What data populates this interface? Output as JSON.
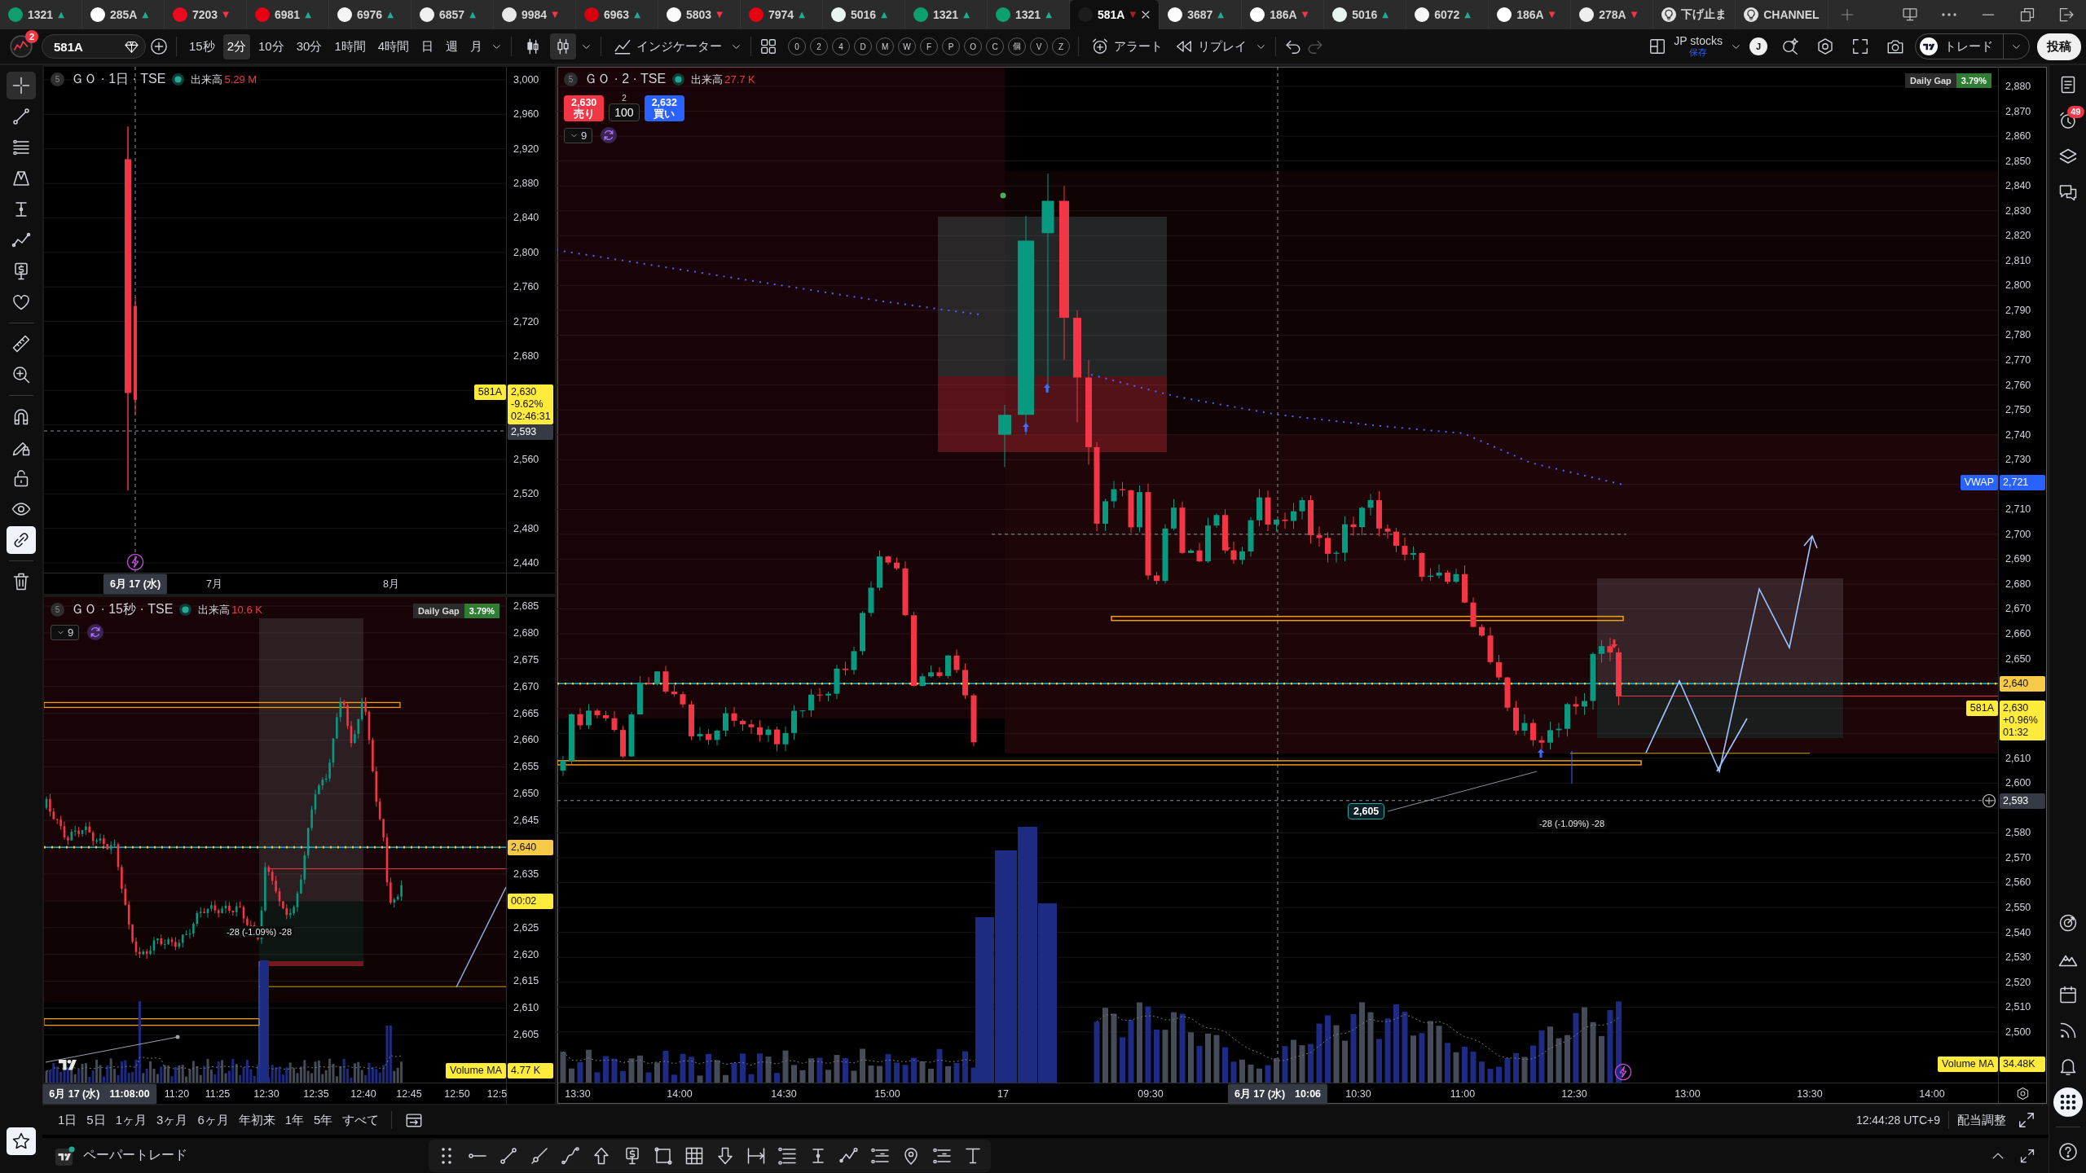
{
  "tabs": [
    {
      "kind": "symbol",
      "label": "1321",
      "trend": {
        "mark": "▲",
        "color": "#22ab94"
      },
      "color": "#0e9f6e",
      "selected": false
    },
    {
      "kind": "symbol",
      "label": "285A",
      "trend": {
        "mark": "▲",
        "color": "#22ab94"
      },
      "color": "#ffffff",
      "selected": false
    },
    {
      "kind": "symbol",
      "label": "7203",
      "trend": {
        "mark": "▼",
        "color": "#f23645"
      },
      "color": "#eb0a1e",
      "selected": false
    },
    {
      "kind": "symbol",
      "label": "6981",
      "trend": {
        "mark": "▲",
        "color": "#22ab94"
      },
      "color": "#e60012",
      "selected": false
    },
    {
      "kind": "symbol",
      "label": "6976",
      "trend": {
        "mark": "▲",
        "color": "#22ab94"
      },
      "color": "#f5f5f5",
      "selected": false
    },
    {
      "kind": "symbol",
      "label": "6857",
      "trend": {
        "mark": "▲",
        "color": "#22ab94"
      },
      "color": "#f0f0f0",
      "selected": false
    },
    {
      "kind": "symbol",
      "label": "9984",
      "trend": {
        "mark": "▼",
        "color": "#f23645"
      },
      "color": "#e8e8e8",
      "selected": false
    },
    {
      "kind": "symbol",
      "label": "6963",
      "trend": {
        "mark": "▲",
        "color": "#22ab94"
      },
      "color": "#d7000f",
      "selected": false
    },
    {
      "kind": "symbol",
      "label": "5803",
      "trend": {
        "mark": "▼",
        "color": "#f23645"
      },
      "color": "#fafafa",
      "selected": false
    },
    {
      "kind": "symbol",
      "label": "7974",
      "trend": {
        "mark": "▲",
        "color": "#22ab94"
      },
      "color": "#e60012",
      "selected": false
    },
    {
      "kind": "symbol",
      "label": "5016",
      "trend": {
        "mark": "▲",
        "color": "#22ab94"
      },
      "color": "#e9f5ef",
      "selected": false
    },
    {
      "kind": "symbol",
      "label": "1321",
      "trend": {
        "mark": "▲",
        "color": "#22ab94"
      },
      "color": "#0e9f6e",
      "selected": false
    },
    {
      "kind": "symbol",
      "label": "1321",
      "trend": {
        "mark": "▲",
        "color": "#22ab94"
      },
      "color": "#0e9f6e",
      "selected": false
    },
    {
      "kind": "symbol",
      "label": "581A",
      "trend": {
        "mark": "▼",
        "color": "#a3202c"
      },
      "color": "#1c1c1c",
      "selected": true
    },
    {
      "kind": "symbol",
      "label": "3687",
      "trend": {
        "mark": "▲",
        "color": "#22ab94"
      },
      "color": "#fcfcfc",
      "selected": false
    },
    {
      "kind": "symbol",
      "label": "186A",
      "trend": {
        "mark": "▼",
        "color": "#f23645"
      },
      "color": "#ffffff",
      "selected": false
    },
    {
      "kind": "symbol",
      "label": "5016",
      "trend": {
        "mark": "▲",
        "color": "#22ab94"
      },
      "color": "#e9f5ef",
      "selected": false
    },
    {
      "kind": "symbol",
      "label": "6072",
      "trend": {
        "mark": "▲",
        "color": "#22ab94"
      },
      "color": "#f7f7f7",
      "selected": false
    },
    {
      "kind": "symbol",
      "label": "186A",
      "trend": {
        "mark": "▼",
        "color": "#f23645"
      },
      "color": "#ffffff",
      "selected": false
    },
    {
      "kind": "symbol",
      "label": "278A",
      "trend": {
        "mark": "▼",
        "color": "#f23645"
      },
      "color": "#eeeeee",
      "selected": false
    },
    {
      "kind": "script",
      "label": "下げ止ま",
      "selected": false
    },
    {
      "kind": "script",
      "label": "CHANNEL",
      "selected": false
    }
  ],
  "toolbar": {
    "notification_count": "2",
    "symbol": "581A",
    "intervals": [
      {
        "label": "15秒",
        "selected": false
      },
      {
        "label": "2分",
        "selected": true
      },
      {
        "label": "10分",
        "selected": false
      },
      {
        "label": "30分",
        "selected": false
      },
      {
        "label": "1時間",
        "selected": false
      },
      {
        "label": "4時間",
        "selected": false
      },
      {
        "label": "日",
        "selected": false
      },
      {
        "label": "週",
        "selected": false
      },
      {
        "label": "月",
        "selected": false
      }
    ],
    "chart_types": [
      {
        "kind": "candles",
        "selected": false
      },
      {
        "kind": "hollow_candles",
        "selected": true
      }
    ],
    "indicators": "インジケーター",
    "quick_buttons": [
      "0",
      "2",
      "4",
      "D",
      "M",
      "W",
      "F",
      "P",
      "O",
      "C",
      "個",
      "V",
      "Z"
    ],
    "alert": "アラート",
    "replay": "リプレイ",
    "layout_name": "JP stocks",
    "layout_status": "保存",
    "user_initial": "J",
    "trade": "トレード",
    "publish": "投稿"
  },
  "left_toolbar": {
    "tool_groups": [
      [
        {
          "kind": "crosshair",
          "selected": true
        },
        {
          "kind": "trend_line",
          "selected": false
        },
        {
          "kind": "parallel_lines",
          "selected": false
        },
        {
          "kind": "pattern",
          "selected": false
        },
        {
          "kind": "measure",
          "selected": false
        },
        {
          "kind": "path",
          "selected": false
        },
        {
          "kind": "price_note",
          "selected": false
        },
        {
          "kind": "heart",
          "selected": false
        }
      ],
      [
        {
          "kind": "ruler",
          "selected": false
        },
        {
          "kind": "zoom",
          "selected": false
        }
      ]
    ],
    "toggles": [
      {
        "kind": "magnet",
        "on": false
      },
      {
        "kind": "pencil_lock",
        "on": false
      },
      {
        "kind": "lock",
        "on": false
      },
      {
        "kind": "eye",
        "on": false
      },
      {
        "kind": "link",
        "on": true
      }
    ],
    "favorites_on": true
  },
  "charts": [
    {
      "badge": "5",
      "title": "ＧＯ · 1日 · TSE",
      "volume_label": "出来高",
      "volume_value": "5.29 M",
      "price_axis": [
        "3,000",
        "2,960",
        "2,920",
        "2,880",
        "2,840",
        "2,800",
        "2,760",
        "2,720",
        "2,680",
        "2,560",
        "2,520",
        "2,480",
        "2,440"
      ],
      "time_axis": [
        {
          "kind": "cursor",
          "label": "6月 17 (水)"
        },
        {
          "kind": "tick",
          "label": "7月"
        },
        {
          "kind": "tick",
          "label": "8月"
        }
      ],
      "price_tags": [
        {
          "kind": "last",
          "label": "581A",
          "lines": [
            "2,630",
            "-9.62%",
            "02:46:31"
          ]
        },
        {
          "kind": "cursor",
          "lines": [
            "2,593"
          ]
        }
      ]
    },
    {
      "badge": "5",
      "title": "ＧＯ · 15秒 · TSE",
      "volume_label": "出来高",
      "volume_value": "10.6 K",
      "indicator_toggle": "9",
      "daily_gap": {
        "label": "Daily Gap",
        "value": "3.79%"
      },
      "measure_label": "-28 (-1.09%) -28",
      "price_axis": [
        "2,685",
        "2,680",
        "2,675",
        "2,670",
        "2,665",
        "2,660",
        "2,655",
        "2,650",
        "2,645",
        "2,635",
        "2,625",
        "2,620",
        "2,615",
        "2,610",
        "2,605"
      ],
      "time_axis": [
        {
          "kind": "cursor",
          "label": "6月 17 (水)",
          "time": "11:08:00"
        },
        {
          "kind": "tick",
          "label": "11:20"
        },
        {
          "kind": "tick",
          "label": "11:25"
        },
        {
          "kind": "tick",
          "label": "12:30"
        },
        {
          "kind": "tick",
          "label": "12:35"
        },
        {
          "kind": "tick",
          "label": "12:40"
        },
        {
          "kind": "tick",
          "label": "12:45"
        },
        {
          "kind": "tick",
          "label": "12:50"
        },
        {
          "kind": "tick",
          "label": "12:5"
        }
      ],
      "price_tags": [
        {
          "kind": "line",
          "lines": [
            "2,640"
          ]
        },
        {
          "kind": "countdown",
          "lines": [
            "00:02"
          ]
        },
        {
          "kind": "volume_ma",
          "label": "Volume MA",
          "lines": [
            "4.77 K"
          ]
        }
      ]
    },
    {
      "badge": "5",
      "title": "ＧＯ · 2 · TSE",
      "volume_label": "出来高",
      "volume_value": "27.7 K",
      "order_panel": {
        "sell_price": "2,630",
        "sell_label": "売り",
        "quantity_step": "2",
        "quantity": "100",
        "buy_price": "2,632",
        "buy_label": "買い"
      },
      "indicator_toggle": "9",
      "daily_gap": {
        "label": "Daily Gap",
        "value": "3.79%"
      },
      "price_note": "2,605",
      "measure_label": "-28 (-1.09%) -28",
      "price_axis": [
        "2,880",
        "2,870",
        "2,860",
        "2,850",
        "2,840",
        "2,830",
        "2,820",
        "2,810",
        "2,800",
        "2,790",
        "2,780",
        "2,770",
        "2,760",
        "2,750",
        "2,740",
        "2,730",
        "2,710",
        "2,700",
        "2,690",
        "2,680",
        "2,670",
        "2,660",
        "2,650",
        "2,610",
        "2,600",
        "2,580",
        "2,570",
        "2,560",
        "2,550",
        "2,540",
        "2,530",
        "2,520",
        "2,510",
        "2,500"
      ],
      "time_axis": [
        {
          "kind": "tick",
          "label": "13:30"
        },
        {
          "kind": "tick",
          "label": "14:00"
        },
        {
          "kind": "tick",
          "label": "14:30"
        },
        {
          "kind": "tick",
          "label": "15:00"
        },
        {
          "kind": "tick",
          "label": "17"
        },
        {
          "kind": "tick",
          "label": "09:30"
        },
        {
          "kind": "cursor",
          "label": "6月 17 (水)",
          "time": "10:06"
        },
        {
          "kind": "tick",
          "label": "10:30"
        },
        {
          "kind": "tick",
          "label": "11:00"
        },
        {
          "kind": "tick",
          "label": "12:30"
        },
        {
          "kind": "tick",
          "label": "13:00"
        },
        {
          "kind": "tick",
          "label": "13:30"
        },
        {
          "kind": "tick",
          "label": "14:00"
        }
      ],
      "price_tags": [
        {
          "kind": "vwap",
          "label": "VWAP",
          "lines": [
            "2,721"
          ]
        },
        {
          "kind": "line",
          "lines": [
            "2,640"
          ]
        },
        {
          "kind": "last",
          "label": "581A",
          "lines": [
            "2,630",
            "+0.96%",
            "01:32"
          ]
        },
        {
          "kind": "cursor",
          "lines": [
            "2,593"
          ]
        },
        {
          "kind": "volume_ma",
          "label": "Volume MA",
          "lines": [
            "34.48K"
          ]
        }
      ]
    }
  ],
  "range_bar": {
    "ranges": [
      "1日",
      "5日",
      "1ヶ月",
      "3ヶ月",
      "6ヶ月",
      "年初来",
      "1年",
      "5年",
      "すべて"
    ],
    "clock": "12:44:28 UTC+9",
    "adjustment": "配当調整"
  },
  "bottom_panel": {
    "tab": "ペーパートレード"
  },
  "right_sidebar": {
    "top": [
      {
        "kind": "watchlist",
        "selected": false
      },
      {
        "kind": "alerts",
        "badge": "49",
        "selected": false
      },
      {
        "kind": "layers",
        "selected": false
      },
      {
        "kind": "chat",
        "selected": false
      }
    ],
    "bottom": [
      {
        "kind": "target",
        "selected": false
      },
      {
        "kind": "ideas",
        "selected": false
      },
      {
        "kind": "calendar",
        "selected": false
      },
      {
        "kind": "rss",
        "selected": false
      },
      {
        "kind": "bell",
        "selected": false
      },
      {
        "kind": "apps",
        "selected": true
      }
    ]
  }
}
